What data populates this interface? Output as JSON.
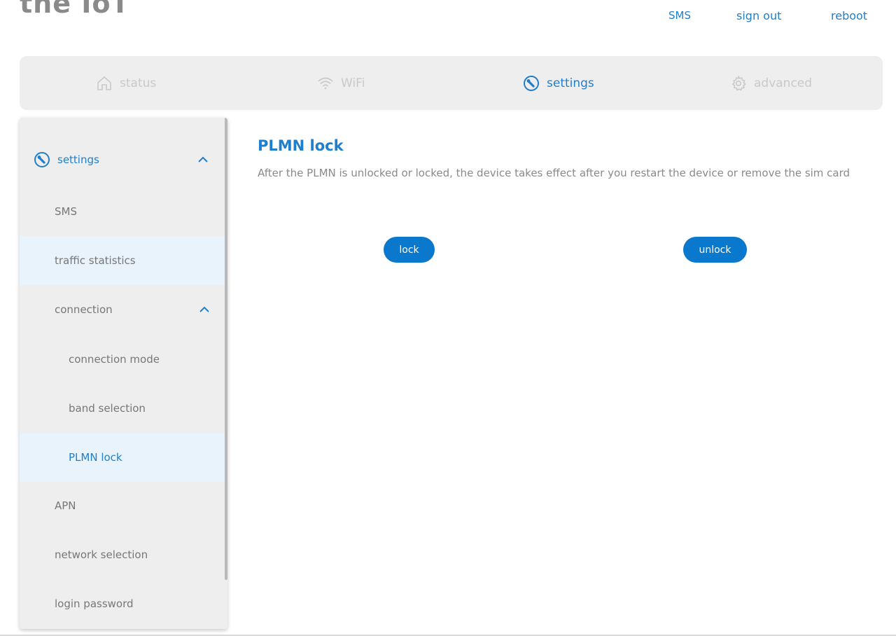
{
  "header": {
    "logo": "the IoT",
    "links": {
      "sms": "SMS",
      "signout": "sign out",
      "reboot": "reboot"
    }
  },
  "nav": {
    "tabs": [
      {
        "label": "status",
        "icon": "home-icon"
      },
      {
        "label": "WiFi",
        "icon": "wifi-icon"
      },
      {
        "label": "settings",
        "icon": "settings-wrench-icon"
      },
      {
        "label": "advanced",
        "icon": "gear-icon"
      }
    ],
    "active": "settings"
  },
  "sidebar": {
    "title": "settings",
    "items": [
      {
        "label": "SMS"
      },
      {
        "label": "traffic statistics"
      },
      {
        "label": "connection"
      },
      {
        "label": "connection mode"
      },
      {
        "label": "band selection"
      },
      {
        "label": "PLMN lock"
      },
      {
        "label": "APN"
      },
      {
        "label": "network selection"
      },
      {
        "label": "login password"
      }
    ]
  },
  "main": {
    "title": "PLMN lock",
    "description": "After the PLMN is unlocked or locked, the device takes effect after you restart the device or remove the sim card",
    "lock_label": "lock",
    "unlock_label": "unlock"
  },
  "colors": {
    "accent": "#1f7fcc",
    "button": "#0a78cc",
    "panel": "#eeeeee",
    "selected": "#e8f3fc"
  }
}
